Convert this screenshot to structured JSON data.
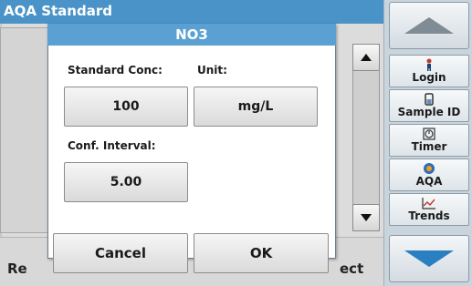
{
  "screen": {
    "title": "AQA Standard",
    "bottom_left_label": "Re",
    "bottom_right_label": "ect"
  },
  "toolbar": {
    "items": [
      {
        "label": "Login",
        "icon": "person-icon"
      },
      {
        "label": "Sample ID",
        "icon": "sample-vial-icon"
      },
      {
        "label": "Timer",
        "icon": "timer-icon"
      },
      {
        "label": "AQA",
        "icon": "aqa-icon"
      },
      {
        "label": "Trends",
        "icon": "trends-chart-icon"
      }
    ]
  },
  "dialog": {
    "title": "NO3",
    "standard_conc_label": "Standard Conc:",
    "standard_conc_value": "100",
    "unit_label": "Unit:",
    "unit_value": "mg/L",
    "conf_interval_label": "Conf. Interval:",
    "conf_interval_value": "5.00",
    "cancel_label": "Cancel",
    "ok_label": "OK"
  },
  "colors": {
    "titlebar": "#4a93c8",
    "dialog_title": "#5aa0d2",
    "toolbar": "#c9d4dc"
  }
}
